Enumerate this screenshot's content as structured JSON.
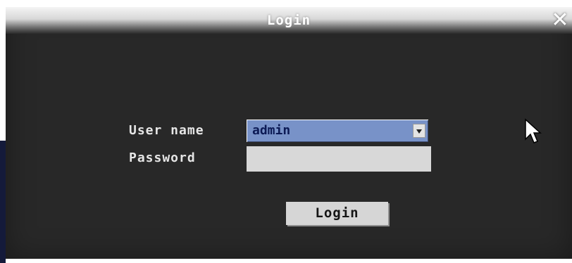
{
  "dialog": {
    "title": "Login",
    "close_icon": "close-icon"
  },
  "form": {
    "username_label": "User name",
    "username_value": "admin",
    "password_label": "Password",
    "password_value": "",
    "submit_label": "Login"
  },
  "icons": {
    "cursor": "mouse-pointer-icon",
    "dropdown": "chevron-down-icon"
  },
  "colors": {
    "dialog_bg": "#282828",
    "select_bg": "#7892c8",
    "field_bg": "#d8d8d8",
    "button_bg": "#d6d6d6"
  }
}
